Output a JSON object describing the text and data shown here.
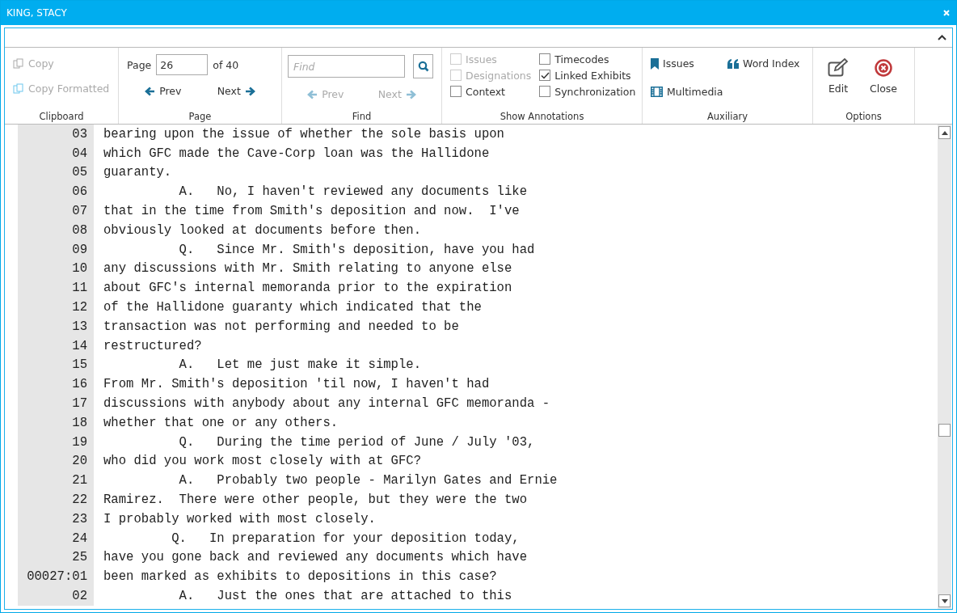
{
  "window": {
    "title": "KING, STACY"
  },
  "ribbon": {
    "clipboard": {
      "label": "Clipboard",
      "items": [
        {
          "label": "Copy",
          "disabled": true
        },
        {
          "label": "Copy Formatted",
          "disabled": true
        }
      ]
    },
    "page": {
      "label": "Page",
      "prefix": "Page",
      "value": "26",
      "suffix": "of 40",
      "prev": {
        "label": "Prev",
        "disabled": false
      },
      "next": {
        "label": "Next",
        "disabled": false
      }
    },
    "find": {
      "label": "Find",
      "placeholder": "Find",
      "prev": {
        "label": "Prev",
        "disabled": true
      },
      "next": {
        "label": "Next",
        "disabled": true
      }
    },
    "annotations": {
      "label": "Show Annotations",
      "columns": [
        [
          {
            "label": "Issues",
            "checked": false,
            "disabled": true
          },
          {
            "label": "Designations",
            "checked": false,
            "disabled": true
          },
          {
            "label": "Context",
            "checked": false,
            "disabled": false
          }
        ],
        [
          {
            "label": "Timecodes",
            "checked": false,
            "disabled": false
          },
          {
            "label": "Linked Exhibits",
            "checked": true,
            "disabled": false
          },
          {
            "label": "Synchronization",
            "checked": false,
            "disabled": false
          }
        ]
      ]
    },
    "auxiliary": {
      "label": "Auxiliary",
      "items": [
        {
          "kind": "bookmark",
          "label": "Issues"
        },
        {
          "kind": "quote",
          "label": "Word Index"
        },
        {
          "kind": "film",
          "label": "Multimedia"
        }
      ]
    },
    "options": {
      "label": "Options",
      "items": [
        {
          "kind": "edit",
          "label": "Edit"
        },
        {
          "kind": "close",
          "label": "Close"
        }
      ]
    }
  },
  "transcript": [
    {
      "number": "03",
      "text": "bearing upon the issue of whether the sole basis upon"
    },
    {
      "number": "04",
      "text": "which GFC made the Cave-Corp loan was the Hallidone"
    },
    {
      "number": "05",
      "text": "guaranty."
    },
    {
      "number": "06",
      "text": "          A.   No, I haven't reviewed any documents like"
    },
    {
      "number": "07",
      "text": "that in the time from Smith's deposition and now.  I've"
    },
    {
      "number": "08",
      "text": "obviously looked at documents before then."
    },
    {
      "number": "09",
      "text": "          Q.   Since Mr. Smith's deposition, have you had"
    },
    {
      "number": "10",
      "text": "any discussions with Mr. Smith relating to anyone else"
    },
    {
      "number": "11",
      "text": "about GFC's internal memoranda prior to the expiration"
    },
    {
      "number": "12",
      "text": "of the Hallidone guaranty which indicated that the"
    },
    {
      "number": "13",
      "text": "transaction was not performing and needed to be"
    },
    {
      "number": "14",
      "text": "restructured?"
    },
    {
      "number": "15",
      "text": "          A.   Let me just make it simple."
    },
    {
      "number": "16",
      "text": "From Mr. Smith's deposition 'til now, I haven't had"
    },
    {
      "number": "17",
      "text": "discussions with anybody about any internal GFC memoranda -"
    },
    {
      "number": "18",
      "text": "whether that one or any others."
    },
    {
      "number": "19",
      "text": "          Q.   During the time period of June / July '03,"
    },
    {
      "number": "20",
      "text": "who did you work most closely with at GFC?"
    },
    {
      "number": "21",
      "text": "          A.   Probably two people - Marilyn Gates and Ernie"
    },
    {
      "number": "22",
      "text": "Ramirez.  There were other people, but they were the two"
    },
    {
      "number": "23",
      "text": "I probably worked with most closely."
    },
    {
      "number": "24",
      "text": "         Q.   In preparation for your deposition today,"
    },
    {
      "number": "25",
      "text": "have you gone back and reviewed any documents which have"
    },
    {
      "number": "00027:01",
      "text": "been marked as exhibits to depositions in this case?"
    },
    {
      "number": "02",
      "text": "          A.   Just the ones that are attached to this"
    }
  ]
}
